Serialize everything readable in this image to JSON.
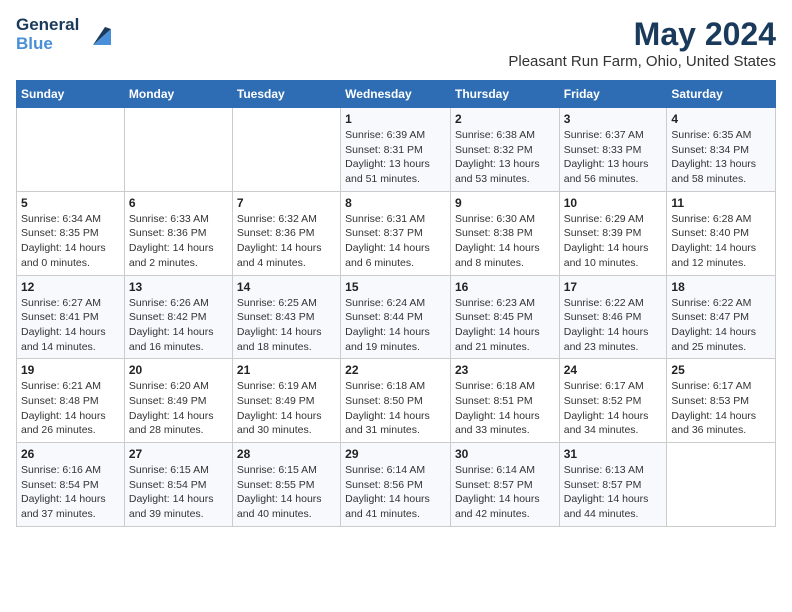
{
  "header": {
    "logo_line1": "General",
    "logo_line2": "Blue",
    "title": "May 2024",
    "subtitle": "Pleasant Run Farm, Ohio, United States"
  },
  "days_of_week": [
    "Sunday",
    "Monday",
    "Tuesday",
    "Wednesday",
    "Thursday",
    "Friday",
    "Saturday"
  ],
  "weeks": [
    [
      {
        "day": "",
        "info": ""
      },
      {
        "day": "",
        "info": ""
      },
      {
        "day": "",
        "info": ""
      },
      {
        "day": "1",
        "info": "Sunrise: 6:39 AM\nSunset: 8:31 PM\nDaylight: 13 hours and 51 minutes."
      },
      {
        "day": "2",
        "info": "Sunrise: 6:38 AM\nSunset: 8:32 PM\nDaylight: 13 hours and 53 minutes."
      },
      {
        "day": "3",
        "info": "Sunrise: 6:37 AM\nSunset: 8:33 PM\nDaylight: 13 hours and 56 minutes."
      },
      {
        "day": "4",
        "info": "Sunrise: 6:35 AM\nSunset: 8:34 PM\nDaylight: 13 hours and 58 minutes."
      }
    ],
    [
      {
        "day": "5",
        "info": "Sunrise: 6:34 AM\nSunset: 8:35 PM\nDaylight: 14 hours and 0 minutes."
      },
      {
        "day": "6",
        "info": "Sunrise: 6:33 AM\nSunset: 8:36 PM\nDaylight: 14 hours and 2 minutes."
      },
      {
        "day": "7",
        "info": "Sunrise: 6:32 AM\nSunset: 8:36 PM\nDaylight: 14 hours and 4 minutes."
      },
      {
        "day": "8",
        "info": "Sunrise: 6:31 AM\nSunset: 8:37 PM\nDaylight: 14 hours and 6 minutes."
      },
      {
        "day": "9",
        "info": "Sunrise: 6:30 AM\nSunset: 8:38 PM\nDaylight: 14 hours and 8 minutes."
      },
      {
        "day": "10",
        "info": "Sunrise: 6:29 AM\nSunset: 8:39 PM\nDaylight: 14 hours and 10 minutes."
      },
      {
        "day": "11",
        "info": "Sunrise: 6:28 AM\nSunset: 8:40 PM\nDaylight: 14 hours and 12 minutes."
      }
    ],
    [
      {
        "day": "12",
        "info": "Sunrise: 6:27 AM\nSunset: 8:41 PM\nDaylight: 14 hours and 14 minutes."
      },
      {
        "day": "13",
        "info": "Sunrise: 6:26 AM\nSunset: 8:42 PM\nDaylight: 14 hours and 16 minutes."
      },
      {
        "day": "14",
        "info": "Sunrise: 6:25 AM\nSunset: 8:43 PM\nDaylight: 14 hours and 18 minutes."
      },
      {
        "day": "15",
        "info": "Sunrise: 6:24 AM\nSunset: 8:44 PM\nDaylight: 14 hours and 19 minutes."
      },
      {
        "day": "16",
        "info": "Sunrise: 6:23 AM\nSunset: 8:45 PM\nDaylight: 14 hours and 21 minutes."
      },
      {
        "day": "17",
        "info": "Sunrise: 6:22 AM\nSunset: 8:46 PM\nDaylight: 14 hours and 23 minutes."
      },
      {
        "day": "18",
        "info": "Sunrise: 6:22 AM\nSunset: 8:47 PM\nDaylight: 14 hours and 25 minutes."
      }
    ],
    [
      {
        "day": "19",
        "info": "Sunrise: 6:21 AM\nSunset: 8:48 PM\nDaylight: 14 hours and 26 minutes."
      },
      {
        "day": "20",
        "info": "Sunrise: 6:20 AM\nSunset: 8:49 PM\nDaylight: 14 hours and 28 minutes."
      },
      {
        "day": "21",
        "info": "Sunrise: 6:19 AM\nSunset: 8:49 PM\nDaylight: 14 hours and 30 minutes."
      },
      {
        "day": "22",
        "info": "Sunrise: 6:18 AM\nSunset: 8:50 PM\nDaylight: 14 hours and 31 minutes."
      },
      {
        "day": "23",
        "info": "Sunrise: 6:18 AM\nSunset: 8:51 PM\nDaylight: 14 hours and 33 minutes."
      },
      {
        "day": "24",
        "info": "Sunrise: 6:17 AM\nSunset: 8:52 PM\nDaylight: 14 hours and 34 minutes."
      },
      {
        "day": "25",
        "info": "Sunrise: 6:17 AM\nSunset: 8:53 PM\nDaylight: 14 hours and 36 minutes."
      }
    ],
    [
      {
        "day": "26",
        "info": "Sunrise: 6:16 AM\nSunset: 8:54 PM\nDaylight: 14 hours and 37 minutes."
      },
      {
        "day": "27",
        "info": "Sunrise: 6:15 AM\nSunset: 8:54 PM\nDaylight: 14 hours and 39 minutes."
      },
      {
        "day": "28",
        "info": "Sunrise: 6:15 AM\nSunset: 8:55 PM\nDaylight: 14 hours and 40 minutes."
      },
      {
        "day": "29",
        "info": "Sunrise: 6:14 AM\nSunset: 8:56 PM\nDaylight: 14 hours and 41 minutes."
      },
      {
        "day": "30",
        "info": "Sunrise: 6:14 AM\nSunset: 8:57 PM\nDaylight: 14 hours and 42 minutes."
      },
      {
        "day": "31",
        "info": "Sunrise: 6:13 AM\nSunset: 8:57 PM\nDaylight: 14 hours and 44 minutes."
      },
      {
        "day": "",
        "info": ""
      }
    ]
  ]
}
